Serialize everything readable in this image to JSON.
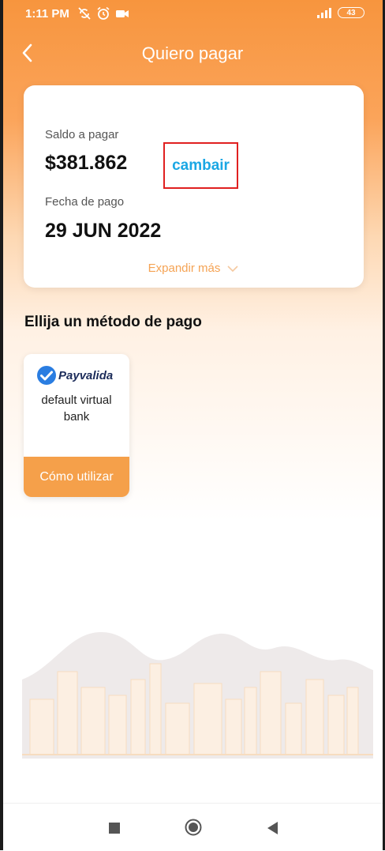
{
  "status_bar": {
    "time": "1:11 PM",
    "battery": "43",
    "icons_left": [
      "sync-off-icon",
      "alarm-icon",
      "video-icon"
    ],
    "icons_right": [
      "signal-icon",
      "battery-icon"
    ]
  },
  "header": {
    "title": "Quiero pagar",
    "back_icon": "chevron-left-icon"
  },
  "summary": {
    "balance_label": "Saldo a pagar",
    "balance_amount": "$381.862",
    "change_label": "cambair",
    "date_label": "Fecha de pago",
    "date_value": "29 JUN 2022",
    "expand_label": "Expandir más"
  },
  "methods": {
    "title": "Ellija un método de pago",
    "items": [
      {
        "logo_text": "Payvalida",
        "name": "default virtual bank",
        "action_label": "Cómo utilizar"
      }
    ]
  },
  "nav": {
    "icons": [
      "recent-apps-icon",
      "home-icon",
      "back-icon"
    ]
  },
  "colors": {
    "accent": "#f7953e",
    "link": "#1aa7e4",
    "highlight_border": "#e02020",
    "button": "#f5a04a"
  }
}
